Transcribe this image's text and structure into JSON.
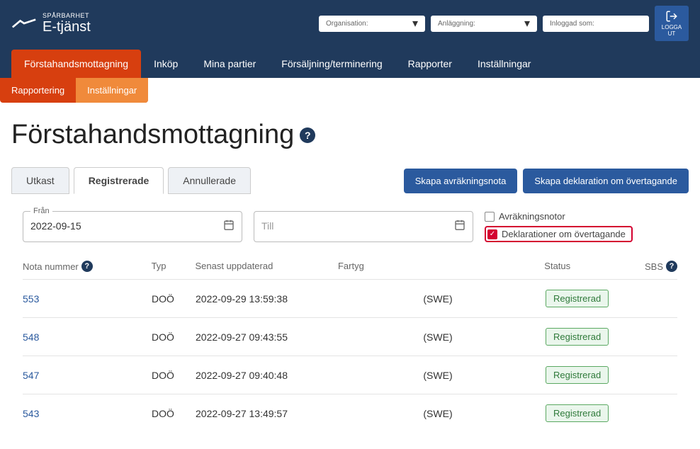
{
  "logo": {
    "small": "SPÅRBARHET",
    "big": "E-tjänst"
  },
  "header": {
    "org_label": "Organisation:",
    "facility_label": "Anläggning:",
    "logged_label": "Inloggad som:",
    "logout": "LOGGA UT"
  },
  "nav": [
    "Förstahandsmottagning",
    "Inköp",
    "Mina partier",
    "Försäljning/terminering",
    "Rapporter",
    "Inställningar"
  ],
  "subnav": [
    "Rapportering",
    "Inställningar"
  ],
  "page_title": "Förstahandsmottagning",
  "tabs": [
    "Utkast",
    "Registrerade",
    "Annullerade"
  ],
  "actions": {
    "create_receipt": "Skapa avräkningsnota",
    "create_decl": "Skapa deklaration om övertagande"
  },
  "filters": {
    "from_label": "Från",
    "from_value": "2022-09-15",
    "to_label": "Till",
    "cb_receipts": "Avräkningsnotor",
    "cb_declarations": "Deklarationer om övertagande"
  },
  "columns": {
    "nota": "Nota nummer",
    "typ": "Typ",
    "updated": "Senast uppdaterad",
    "fartyg": "Fartyg",
    "status": "Status",
    "sbs": "SBS"
  },
  "rows": [
    {
      "nota": "553",
      "typ": "DOÖ",
      "updated": "2022-09-29 13:59:38",
      "fartyg": "(SWE)",
      "status": "Registrerad"
    },
    {
      "nota": "548",
      "typ": "DOÖ",
      "updated": "2022-09-27 09:43:55",
      "fartyg": "(SWE)",
      "status": "Registrerad"
    },
    {
      "nota": "547",
      "typ": "DOÖ",
      "updated": "2022-09-27 09:40:48",
      "fartyg": "(SWE)",
      "status": "Registrerad"
    },
    {
      "nota": "543",
      "typ": "DOÖ",
      "updated": "2022-09-27 13:49:57",
      "fartyg": "(SWE)",
      "status": "Registrerad"
    }
  ]
}
